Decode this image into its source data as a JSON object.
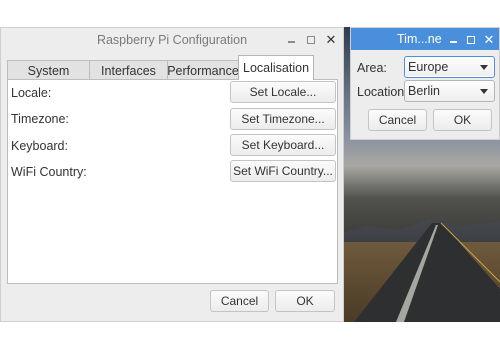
{
  "main_window": {
    "title": "Raspberry Pi Configuration",
    "tabs": [
      {
        "label": "System"
      },
      {
        "label": "Interfaces"
      },
      {
        "label": "Performance"
      },
      {
        "label": "Localisation",
        "active": true
      }
    ],
    "rows": [
      {
        "label": "Locale:",
        "button": "Set Locale..."
      },
      {
        "label": "Timezone:",
        "button": "Set Timezone..."
      },
      {
        "label": "Keyboard:",
        "button": "Set Keyboard..."
      },
      {
        "label": "WiFi Country:",
        "button": "Set WiFi Country..."
      }
    ],
    "cancel_label": "Cancel",
    "ok_label": "OK"
  },
  "timezone_dialog": {
    "title": "Tim...ne",
    "area_label": "Area:",
    "area_value": "Europe",
    "location_label": "Location:",
    "location_value": "Berlin",
    "cancel_label": "Cancel",
    "ok_label": "OK",
    "titlebar_color": "#4a8fdc"
  },
  "icons": {
    "minimize": "minimize-icon",
    "maximize": "maximize-icon",
    "close": "close-icon"
  }
}
